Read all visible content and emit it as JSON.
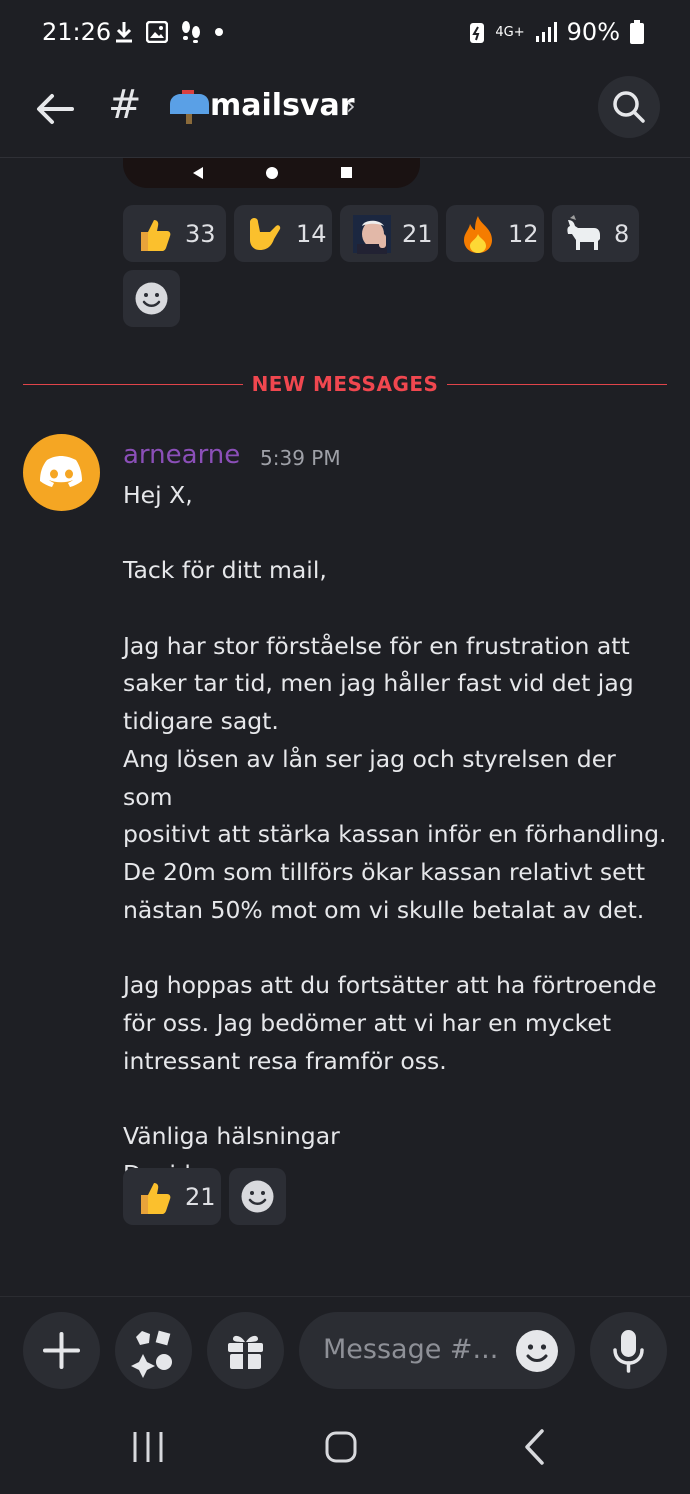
{
  "status_bar": {
    "time": "21:26",
    "network": "4G+",
    "battery": "90%"
  },
  "header": {
    "channel_emoji": "mailbox-icon",
    "channel_name": "mailsvar"
  },
  "prev_reactions": [
    {
      "emoji": "thumbs-up",
      "count": "33"
    },
    {
      "emoji": "call-me-hand",
      "count": "14"
    },
    {
      "emoji": "custom-face",
      "count": "21"
    },
    {
      "emoji": "fire",
      "count": "12"
    },
    {
      "emoji": "goat",
      "count": "8"
    }
  ],
  "divider": {
    "label": "NEW MESSAGES"
  },
  "message": {
    "author": "arnearne",
    "time": "5:39 PM",
    "lines": [
      "Hej X,",
      "",
      "Tack för ditt mail,",
      "",
      "Jag har stor förståelse för en frustration att",
      "saker tar tid, men jag håller fast vid det jag",
      "tidigare sagt.",
      "Ang lösen av lån ser jag och styrelsen der som",
      "positivt att stärka kassan inför en förhandling.",
      "De 20m som tillförs ökar kassan relativt sett",
      "nästan 50% mot om vi skulle betalat av det.",
      "",
      "Jag hoppas att du fortsätter att ha förtroende",
      "för oss. Jag bedömer att vi har en mycket",
      "intressant resa framför oss.",
      "",
      "Vänliga hälsningar",
      "David"
    ],
    "reactions": [
      {
        "emoji": "thumbs-up",
        "count": "21"
      }
    ]
  },
  "composer": {
    "placeholder": "Message #..."
  },
  "colors": {
    "background": "#1e1f24",
    "new_messages": "#f0474f",
    "author": "#8b4fb8",
    "avatar": "#f5a623"
  }
}
